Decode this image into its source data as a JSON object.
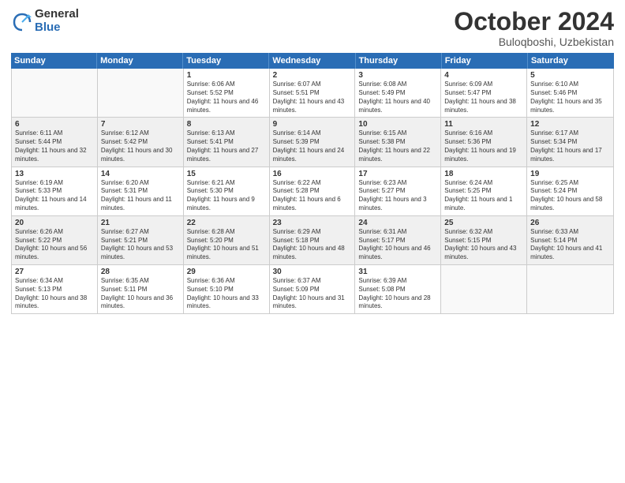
{
  "logo": {
    "general": "General",
    "blue": "Blue"
  },
  "header": {
    "month": "October 2024",
    "location": "Buloqboshi, Uzbekistan"
  },
  "weekdays": [
    "Sunday",
    "Monday",
    "Tuesday",
    "Wednesday",
    "Thursday",
    "Friday",
    "Saturday"
  ],
  "weeks": [
    [
      {
        "day": "",
        "info": ""
      },
      {
        "day": "",
        "info": ""
      },
      {
        "day": "1",
        "info": "Sunrise: 6:06 AM\nSunset: 5:52 PM\nDaylight: 11 hours and 46 minutes."
      },
      {
        "day": "2",
        "info": "Sunrise: 6:07 AM\nSunset: 5:51 PM\nDaylight: 11 hours and 43 minutes."
      },
      {
        "day": "3",
        "info": "Sunrise: 6:08 AM\nSunset: 5:49 PM\nDaylight: 11 hours and 40 minutes."
      },
      {
        "day": "4",
        "info": "Sunrise: 6:09 AM\nSunset: 5:47 PM\nDaylight: 11 hours and 38 minutes."
      },
      {
        "day": "5",
        "info": "Sunrise: 6:10 AM\nSunset: 5:46 PM\nDaylight: 11 hours and 35 minutes."
      }
    ],
    [
      {
        "day": "6",
        "info": "Sunrise: 6:11 AM\nSunset: 5:44 PM\nDaylight: 11 hours and 32 minutes."
      },
      {
        "day": "7",
        "info": "Sunrise: 6:12 AM\nSunset: 5:42 PM\nDaylight: 11 hours and 30 minutes."
      },
      {
        "day": "8",
        "info": "Sunrise: 6:13 AM\nSunset: 5:41 PM\nDaylight: 11 hours and 27 minutes."
      },
      {
        "day": "9",
        "info": "Sunrise: 6:14 AM\nSunset: 5:39 PM\nDaylight: 11 hours and 24 minutes."
      },
      {
        "day": "10",
        "info": "Sunrise: 6:15 AM\nSunset: 5:38 PM\nDaylight: 11 hours and 22 minutes."
      },
      {
        "day": "11",
        "info": "Sunrise: 6:16 AM\nSunset: 5:36 PM\nDaylight: 11 hours and 19 minutes."
      },
      {
        "day": "12",
        "info": "Sunrise: 6:17 AM\nSunset: 5:34 PM\nDaylight: 11 hours and 17 minutes."
      }
    ],
    [
      {
        "day": "13",
        "info": "Sunrise: 6:19 AM\nSunset: 5:33 PM\nDaylight: 11 hours and 14 minutes."
      },
      {
        "day": "14",
        "info": "Sunrise: 6:20 AM\nSunset: 5:31 PM\nDaylight: 11 hours and 11 minutes."
      },
      {
        "day": "15",
        "info": "Sunrise: 6:21 AM\nSunset: 5:30 PM\nDaylight: 11 hours and 9 minutes."
      },
      {
        "day": "16",
        "info": "Sunrise: 6:22 AM\nSunset: 5:28 PM\nDaylight: 11 hours and 6 minutes."
      },
      {
        "day": "17",
        "info": "Sunrise: 6:23 AM\nSunset: 5:27 PM\nDaylight: 11 hours and 3 minutes."
      },
      {
        "day": "18",
        "info": "Sunrise: 6:24 AM\nSunset: 5:25 PM\nDaylight: 11 hours and 1 minute."
      },
      {
        "day": "19",
        "info": "Sunrise: 6:25 AM\nSunset: 5:24 PM\nDaylight: 10 hours and 58 minutes."
      }
    ],
    [
      {
        "day": "20",
        "info": "Sunrise: 6:26 AM\nSunset: 5:22 PM\nDaylight: 10 hours and 56 minutes."
      },
      {
        "day": "21",
        "info": "Sunrise: 6:27 AM\nSunset: 5:21 PM\nDaylight: 10 hours and 53 minutes."
      },
      {
        "day": "22",
        "info": "Sunrise: 6:28 AM\nSunset: 5:20 PM\nDaylight: 10 hours and 51 minutes."
      },
      {
        "day": "23",
        "info": "Sunrise: 6:29 AM\nSunset: 5:18 PM\nDaylight: 10 hours and 48 minutes."
      },
      {
        "day": "24",
        "info": "Sunrise: 6:31 AM\nSunset: 5:17 PM\nDaylight: 10 hours and 46 minutes."
      },
      {
        "day": "25",
        "info": "Sunrise: 6:32 AM\nSunset: 5:15 PM\nDaylight: 10 hours and 43 minutes."
      },
      {
        "day": "26",
        "info": "Sunrise: 6:33 AM\nSunset: 5:14 PM\nDaylight: 10 hours and 41 minutes."
      }
    ],
    [
      {
        "day": "27",
        "info": "Sunrise: 6:34 AM\nSunset: 5:13 PM\nDaylight: 10 hours and 38 minutes."
      },
      {
        "day": "28",
        "info": "Sunrise: 6:35 AM\nSunset: 5:11 PM\nDaylight: 10 hours and 36 minutes."
      },
      {
        "day": "29",
        "info": "Sunrise: 6:36 AM\nSunset: 5:10 PM\nDaylight: 10 hours and 33 minutes."
      },
      {
        "day": "30",
        "info": "Sunrise: 6:37 AM\nSunset: 5:09 PM\nDaylight: 10 hours and 31 minutes."
      },
      {
        "day": "31",
        "info": "Sunrise: 6:39 AM\nSunset: 5:08 PM\nDaylight: 10 hours and 28 minutes."
      },
      {
        "day": "",
        "info": ""
      },
      {
        "day": "",
        "info": ""
      }
    ]
  ]
}
